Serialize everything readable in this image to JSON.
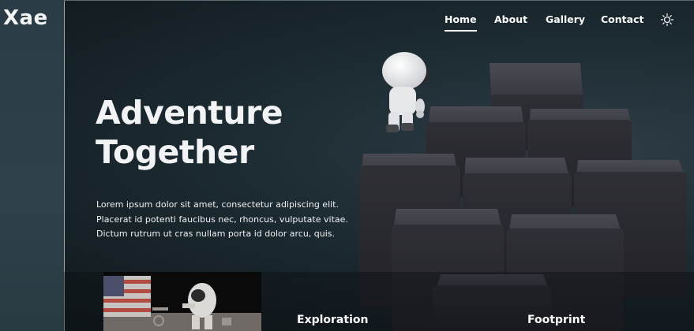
{
  "brand": {
    "logo": "Xae"
  },
  "nav": {
    "items": [
      {
        "label": "Home",
        "active": true
      },
      {
        "label": "About",
        "active": false
      },
      {
        "label": "Gallery",
        "active": false
      },
      {
        "label": "Contact",
        "active": false
      }
    ],
    "theme_toggle_icon": "sun-icon"
  },
  "hero": {
    "title_line1": "Adventure",
    "title_line2": "Together",
    "body_line1": "Lorem ipsum dolor sit amet, consectetur adipiscing elit.",
    "body_line2": "Placerat id potenti faucibus nec, rhoncus, vulputate vitae.",
    "body_line3": "Dictum rutrum ut cras nullam porta id dolor arcu, quis."
  },
  "features": [
    {
      "title": "Exploration"
    },
    {
      "title": "Footprint"
    }
  ],
  "colors": {
    "background": "#1c2a31",
    "sidebar": "#2e414b",
    "text": "#ffffff",
    "cube": "#2c2c33"
  }
}
